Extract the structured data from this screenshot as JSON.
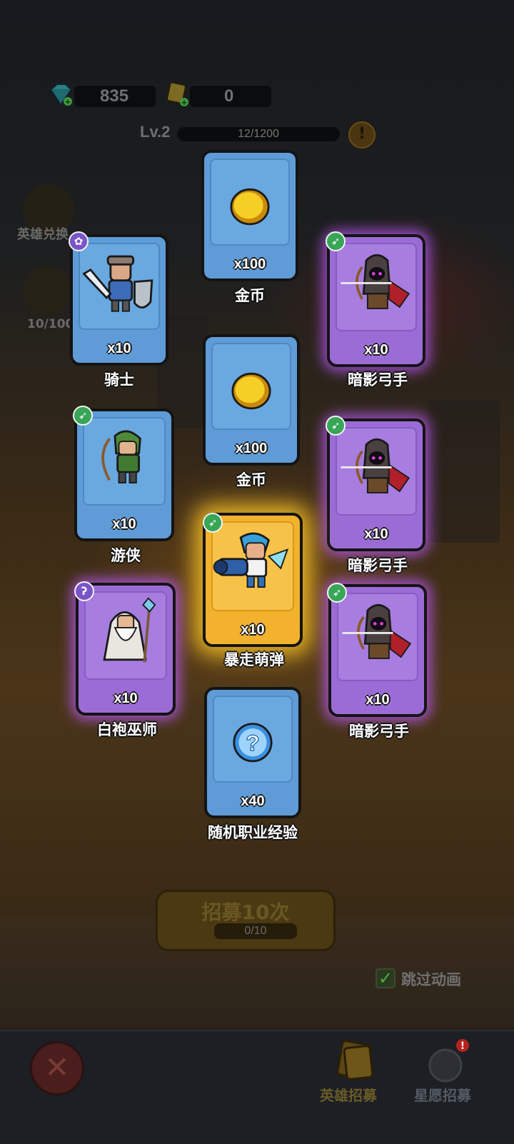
{
  "resources": {
    "gems": "835",
    "tickets": "0"
  },
  "level": {
    "label": "Lv.2",
    "xp": "12/1200",
    "warning": "!"
  },
  "side": {
    "exchange_label": "英雄兑换",
    "star_count": "10/100"
  },
  "cards": [
    {
      "name": "金币",
      "qty": "x100",
      "icon": "gold-coin-icon"
    },
    {
      "name": "骑士",
      "qty": "x10",
      "icon": "knight-hero"
    },
    {
      "name": "暗影弓手",
      "qty": "x10",
      "icon": "shadow-archer-hero"
    },
    {
      "name": "金币",
      "qty": "x100",
      "icon": "gold-coin-icon"
    },
    {
      "name": "游侠",
      "qty": "x10",
      "icon": "ranger-hero"
    },
    {
      "name": "暗影弓手",
      "qty": "x10",
      "icon": "shadow-archer-hero"
    },
    {
      "name": "暴走萌弹",
      "qty": "x10",
      "icon": "cannon-hero"
    },
    {
      "name": "白袍巫师",
      "qty": "x10",
      "icon": "white-wizard-hero"
    },
    {
      "name": "暗影弓手",
      "qty": "x10",
      "icon": "shadow-archer-hero"
    },
    {
      "name": "随机职业经验",
      "qty": "x40",
      "icon": "question-orb-icon"
    }
  ],
  "recruit": {
    "label": "招募10次",
    "count": "0/10"
  },
  "skip": {
    "label": "跳过动画"
  },
  "tabs": {
    "hero_recruit": "英雄招募",
    "wish_recruit": "星愿招募"
  },
  "colors": {
    "blue_card": "#5f9cd7",
    "purple_card": "#9c6cd6",
    "gold_card": "#f2b22e"
  }
}
